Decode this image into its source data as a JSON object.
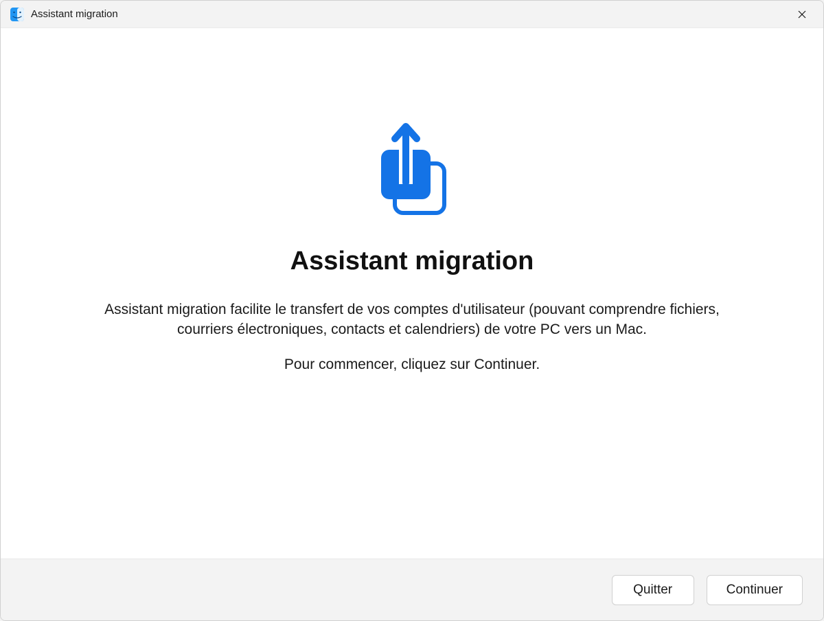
{
  "titlebar": {
    "title": "Assistant migration",
    "icon_name": "finder-face-icon"
  },
  "main": {
    "icon_name": "upload-migration-icon",
    "heading": "Assistant migration",
    "description": "Assistant migration facilite le transfert de vos comptes d'utilisateur (pouvant comprendre fichiers, courriers électroniques, contacts et calendriers) de votre PC vers un Mac.",
    "instruction": "Pour commencer, cliquez sur Continuer."
  },
  "footer": {
    "quit_label": "Quitter",
    "continue_label": "Continuer"
  },
  "colors": {
    "accent": "#1473E6",
    "window_bg": "#f3f3f3",
    "content_bg": "#ffffff"
  }
}
